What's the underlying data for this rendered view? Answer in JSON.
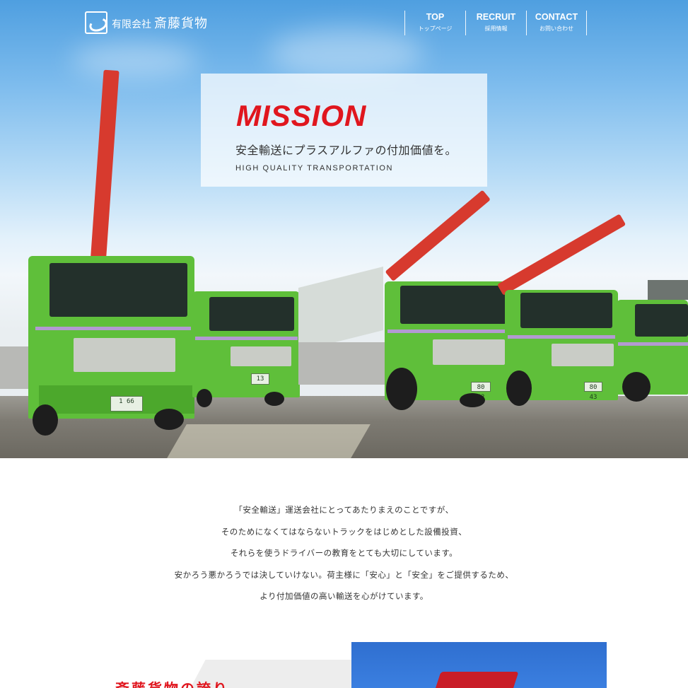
{
  "header": {
    "logo_sub": "有限会社",
    "logo_main": "斎藤貨物",
    "nav": [
      {
        "en": "TOP",
        "jp": "トップページ"
      },
      {
        "en": "RECRUIT",
        "jp": "採用情報"
      },
      {
        "en": "CONTACT",
        "jp": "お問い合わせ"
      }
    ]
  },
  "hero": {
    "title": "MISSION",
    "copy": "安全輸送にプラスアルファの付加価値を。",
    "tagline": "HIGH QUALITY TRANSPORTATION",
    "plates": [
      "1 66",
      "13",
      "80 42",
      "80 43"
    ]
  },
  "intro": {
    "lines": [
      "「安全輸送」運送会社にとってあたりまえのことですが、",
      "そのためになくてはならないトラックをはじめとした設備投資、",
      "それらを使うドライバーの教育をとても大切にしています。",
      "安かろう悪かろうでは決していけない。荷主様に「安心」と「安全」をご提供するため、",
      "より付加価値の高い輸送を心がけています。"
    ]
  },
  "section": {
    "title": "斎藤貨物の誇り"
  },
  "colors": {
    "accent": "#e0161e",
    "truck_green": "#5fbf3a",
    "crane_red": "#d73a2e"
  }
}
